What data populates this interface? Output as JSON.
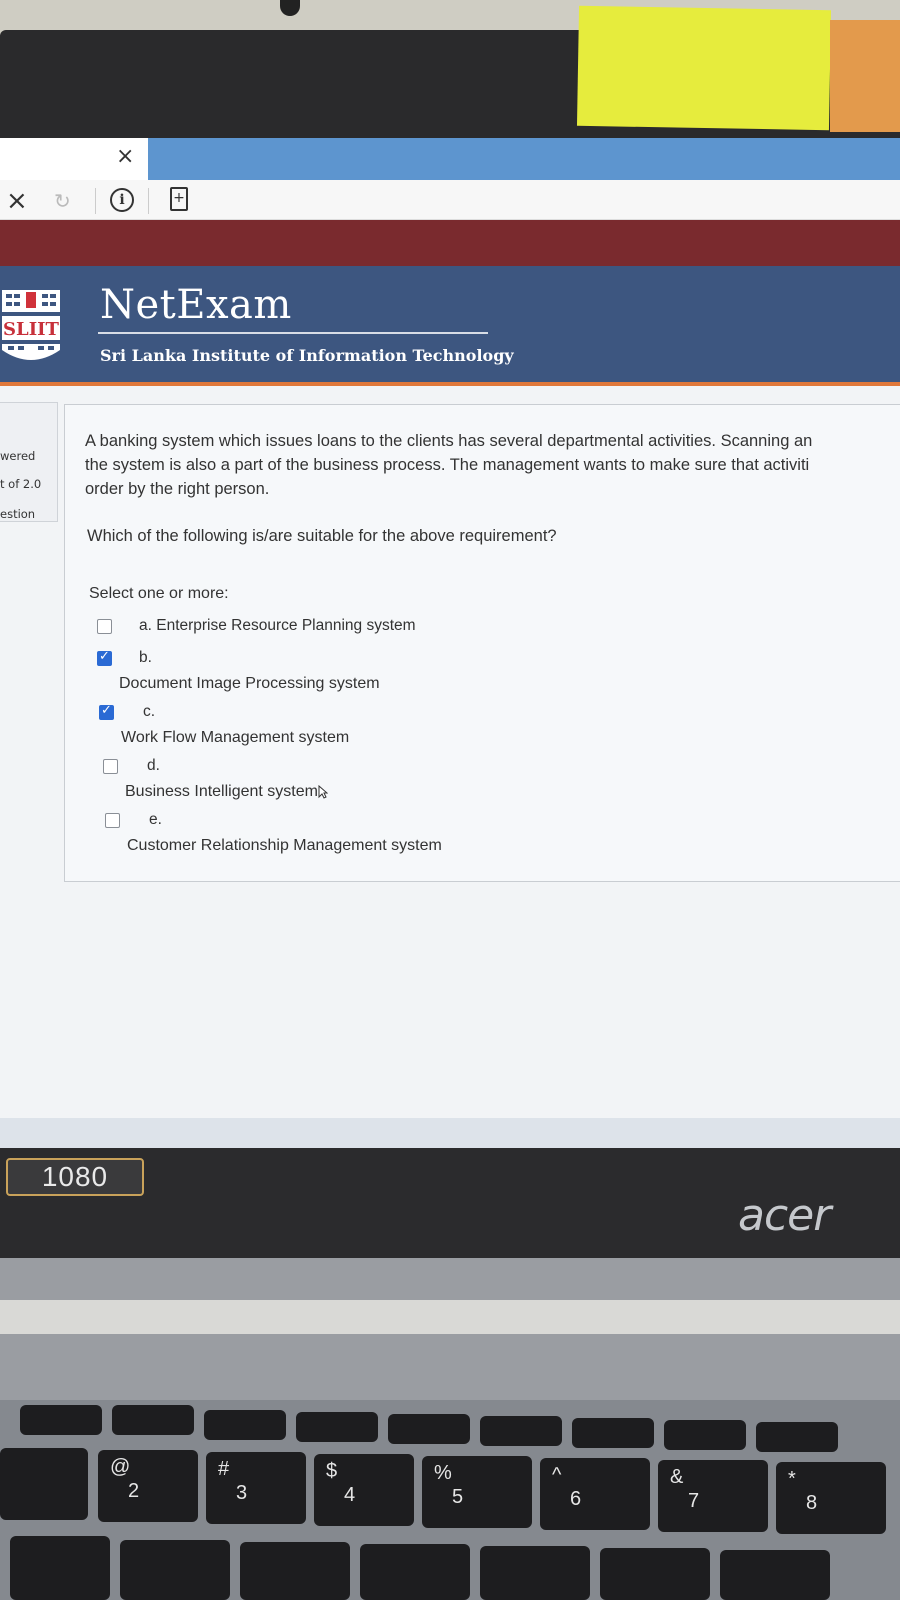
{
  "browser": {
    "tab_close_glyph": "×",
    "stop_glyph": "×",
    "refresh_glyph": "↻",
    "info_glyph": "i",
    "page_glyph": "+"
  },
  "header": {
    "brand": "NetExam",
    "logo_text": "SLIIT",
    "subtitle": "Sri Lanka Institute of Information Technology"
  },
  "side_info": {
    "answered": "wered",
    "marks": "t of 2.0",
    "question": "estion"
  },
  "question": {
    "lines": [
      "A banking system which issues loans to the clients has several departmental activities. Scanning an",
      "the system is also a part of the business process. The management wants to make sure that activiti",
      "order by the right person."
    ],
    "prompt": "Which of the following is/are suitable for the above requirement?",
    "select_label": "Select one or more:",
    "options": [
      {
        "letter": "a. Enterprise Resource Planning system",
        "text": "",
        "checked": false
      },
      {
        "letter": "b.",
        "text": "Document Image Processing system",
        "checked": true
      },
      {
        "letter": "c.",
        "text": "Work Flow Management system",
        "checked": true
      },
      {
        "letter": "d.",
        "text": "Business Intelligent system",
        "checked": false
      },
      {
        "letter": "e.",
        "text": "Customer Relationship Management system",
        "checked": false
      }
    ]
  },
  "device": {
    "sticker": "1080",
    "brand": "acer"
  },
  "keys": [
    {
      "top": "@",
      "bottom": "2"
    },
    {
      "top": "#",
      "bottom": "3"
    },
    {
      "top": "$",
      "bottom": "4"
    },
    {
      "top": "%",
      "bottom": "5"
    },
    {
      "top": "^",
      "bottom": "6"
    },
    {
      "top": "&",
      "bottom": "7"
    },
    {
      "top": "*",
      "bottom": "8"
    }
  ],
  "colors": {
    "header_bg": "#3d5680",
    "header_accent": "#e0783a",
    "checkbox_checked": "#2a6ad4"
  }
}
